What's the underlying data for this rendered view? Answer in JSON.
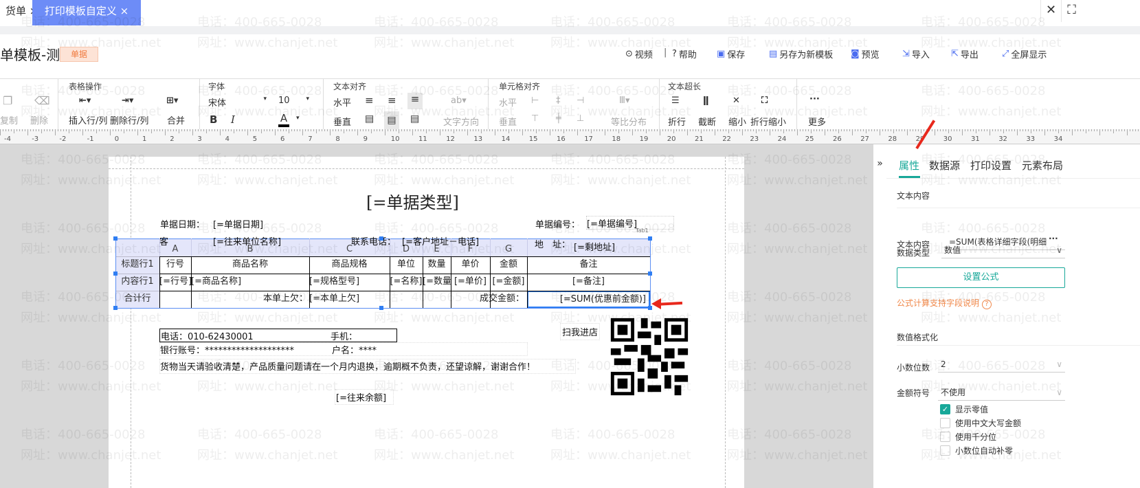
{
  "tabs": [
    {
      "label": "货单",
      "close": "×"
    },
    {
      "label": "打印模板自定义",
      "close": "×"
    }
  ],
  "window": {
    "close": "✕",
    "fullscreen": "⛶"
  },
  "header": {
    "title": "单模板-测",
    "badge": "单据",
    "actions": [
      {
        "icon": "play-icon",
        "glyph": "⊙",
        "label": "视频"
      },
      {
        "icon": "help-icon",
        "glyph": "?",
        "label": "帮助"
      },
      {
        "icon": "save-icon",
        "glyph": "▣",
        "label": "保存"
      },
      {
        "icon": "save-as-icon",
        "glyph": "▤",
        "label": "另存为新模板"
      },
      {
        "icon": "preview-icon",
        "glyph": "◙",
        "label": "预览"
      },
      {
        "icon": "import-icon",
        "glyph": "⇲",
        "label": "导入"
      },
      {
        "icon": "export-icon",
        "glyph": "⇱",
        "label": "导出"
      },
      {
        "icon": "fullscreen-icon",
        "glyph": "⤢",
        "label": "全屏显示"
      }
    ],
    "separator": "|"
  },
  "toolbar": {
    "copy": "复制",
    "delete": "删除",
    "table_ops": {
      "label": "表格操作",
      "insert": "插入行/列",
      "remove": "删除行/列",
      "merge": "合并"
    },
    "font": {
      "label": "字体",
      "family": "宋体",
      "size": "10",
      "bold": "B",
      "italic": "I",
      "color": "A"
    },
    "text_align": {
      "label": "文本对齐",
      "horizontal": "水平",
      "vertical": "垂直",
      "direction": "文字方向",
      "direction_glyph": "ab"
    },
    "cell_align": {
      "label": "单元格对齐",
      "horizontal": "水平",
      "vertical": "垂直",
      "distribute": "等比分布"
    },
    "overflow": {
      "label": "文本超长",
      "wrap": "折行",
      "cut": "截断",
      "shrink": "缩小",
      "wrap_shrink": "折行缩小"
    },
    "more": "更多",
    "more_glyph": "···"
  },
  "ruler": [
    "-4",
    "-3",
    "-2",
    "-1",
    "0",
    "1",
    "2",
    "3",
    "4",
    "5",
    "6",
    "7",
    "8",
    "9",
    "10",
    "11",
    "12",
    "13",
    "14",
    "15",
    "16",
    "17",
    "18",
    "19",
    "20",
    "21",
    "22",
    "23",
    "24",
    "25",
    "26",
    "27",
    "28",
    "29",
    "30",
    "31",
    "32",
    "33",
    "34"
  ],
  "document": {
    "title": "[=单据类型]",
    "date_label": "单据日期：",
    "date_value": "[=单据日期]",
    "number_label": "单据编号：",
    "number_value": "[=单据编号]",
    "tab_tag": "Tab1",
    "customer_label": "客",
    "customer_value": "[=往来单位名称]",
    "phone_label": "联系电话：",
    "phone_value": "[=客户地址－电话]",
    "address_label": "地　址：",
    "address_value": "[=剩地址]",
    "columns": [
      "A",
      "B",
      "C",
      "D",
      "E",
      "F",
      "G",
      ""
    ],
    "row_headers": [
      "标题行1",
      "内容行1",
      "合计行"
    ],
    "header_row": [
      "行号",
      "商品名称",
      "商品规格",
      "单位",
      "数量",
      "单价",
      "金额",
      "备注"
    ],
    "content_row": [
      "[=行号]",
      "[=商品名称]",
      "[=规格型号]",
      "[=名称]",
      "[=数量",
      "[=单价]",
      "[=金额]",
      "[=备注]"
    ],
    "total_row": {
      "owed_label": "本单上欠：",
      "owed_value": "[=本单上欠]",
      "deal_label": "成交金额：",
      "deal_value": "[=SUM(优惠前金额)]"
    },
    "tel": "电话：010-62430001",
    "mobile": "手机：",
    "bank": "银行账号：********************",
    "account_name": "户名：****",
    "notice": "货物当天请验收清楚，产品质量问题请在一个月内退换，逾期概不负责，还望谅解，谢谢合作！",
    "scan": "扫我进店",
    "balance": "[=往来余额]"
  },
  "panel": {
    "tabs": [
      "属性",
      "数据源",
      "打印设置",
      "元素布局"
    ],
    "active_tab": "属性",
    "collapse": "»",
    "section_text": "文本内容",
    "text_label": "文本内容",
    "text_value": "=SUM(表格详细字段(明细",
    "text_more": "···",
    "type_label": "数据类型",
    "type_value": "数值",
    "formula_button": "设置公式",
    "formula_help": "公式计算支持字段说明",
    "help_glyph": "?",
    "section_number": "数值格式化",
    "decimal_label": "小数位数",
    "decimal_value": "2",
    "currency_label": "金额符号",
    "currency_value": "不使用",
    "options": [
      {
        "label": "显示零值",
        "checked": true
      },
      {
        "label": "使用中文大写金额",
        "checked": false
      },
      {
        "label": "使用千分位",
        "checked": false
      },
      {
        "label": "小数位自动补零",
        "checked": false
      }
    ]
  },
  "watermark": {
    "line1": "电话：400-665-0028",
    "line2": "网址：www.chanjet.net"
  },
  "colors": {
    "accent": "#17a899",
    "tab_active": "#6d8cf7",
    "badge": "#f07a3e",
    "help": "#f0884a",
    "arrow": "#e8281c",
    "selection": "#2f7ef3"
  }
}
